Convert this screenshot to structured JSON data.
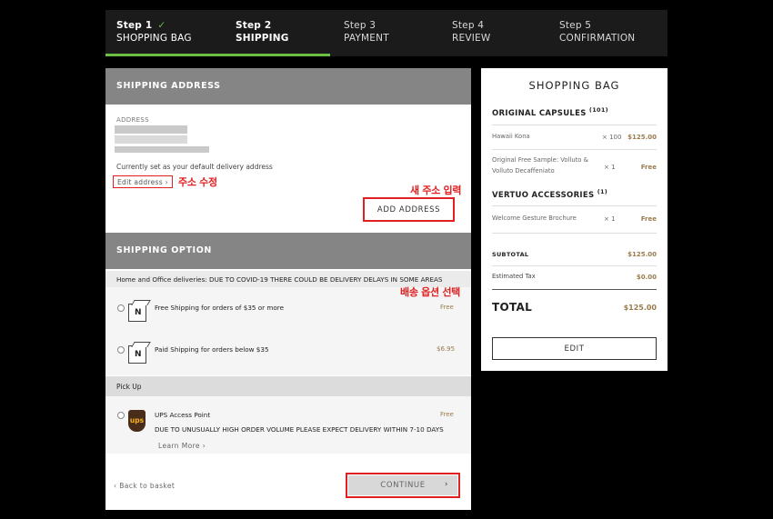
{
  "stepper": {
    "steps": [
      {
        "num": "Step 1",
        "check": "✓",
        "name": "SHOPPING BAG"
      },
      {
        "num": "Step 2",
        "name": "SHIPPING"
      },
      {
        "num": "Step 3",
        "name": "PAYMENT"
      },
      {
        "num": "Step 4",
        "name": "REVIEW"
      },
      {
        "num": "Step 5",
        "name": "CONFIRMATION"
      }
    ],
    "progress": 0.4
  },
  "shipping_address": {
    "header": "SHIPPING ADDRESS",
    "address_label": "ADDRESS",
    "default_note": "Currently set as your default delivery address",
    "edit_link": "Edit address",
    "add_button": "ADD ADDRESS"
  },
  "annotations": {
    "edit_address": "주소 수정",
    "new_address": "새 주소 입력",
    "shipping_option": "배송 옵션 선택"
  },
  "shipping_option": {
    "header": "SHIPPING OPTION",
    "notice": "Home and Office deliveries: DUE TO COVID-19 THERE COULD BE DELIVERY DELAYS IN SOME AREAS",
    "options": [
      {
        "name": "Free Shipping for orders of $35 or more",
        "price": "Free"
      },
      {
        "name": "Paid Shipping for orders below $35",
        "price": "$6.95"
      }
    ],
    "pickup_label": "Pick Up",
    "ups": {
      "name": "UPS Access Point",
      "price": "Free",
      "logo_text": "ups",
      "notice": "DUE TO UNUSUALLY HIGH ORDER VOLUME PLEASE EXPECT DELIVERY WITHIN 7-10 DAYS",
      "learn_more": "Learn More"
    },
    "back_link": "Back to basket",
    "continue_button": "CONTINUE"
  },
  "bag": {
    "title": "SHOPPING BAG",
    "sections": [
      {
        "title": "ORIGINAL CAPSULES",
        "count": "(101)",
        "items": [
          {
            "name": "Hawaii Kona",
            "qty": "× 100",
            "price": "$125.00"
          },
          {
            "name": "Original Free Sample: Volluto & Volluto Decaffeniato",
            "qty": "× 1",
            "price": "Free"
          }
        ]
      },
      {
        "title": "VERTUO ACCESSORIES",
        "count": "(1)",
        "items": [
          {
            "name": "Welcome Gesture Brochure",
            "qty": "× 1",
            "price": "Free"
          }
        ]
      }
    ],
    "subtotal_label": "SUBTOTAL",
    "subtotal": "$125.00",
    "tax_label": "Estimated Tax",
    "tax": "$0.00",
    "total_label": "TOTAL",
    "total": "$125.00",
    "edit_button": "EDIT"
  },
  "colors": {
    "accent_green": "#6bbf43",
    "annotation_red": "#e02020",
    "price_gold": "#9b7b4e",
    "header_gray": "#858585"
  }
}
